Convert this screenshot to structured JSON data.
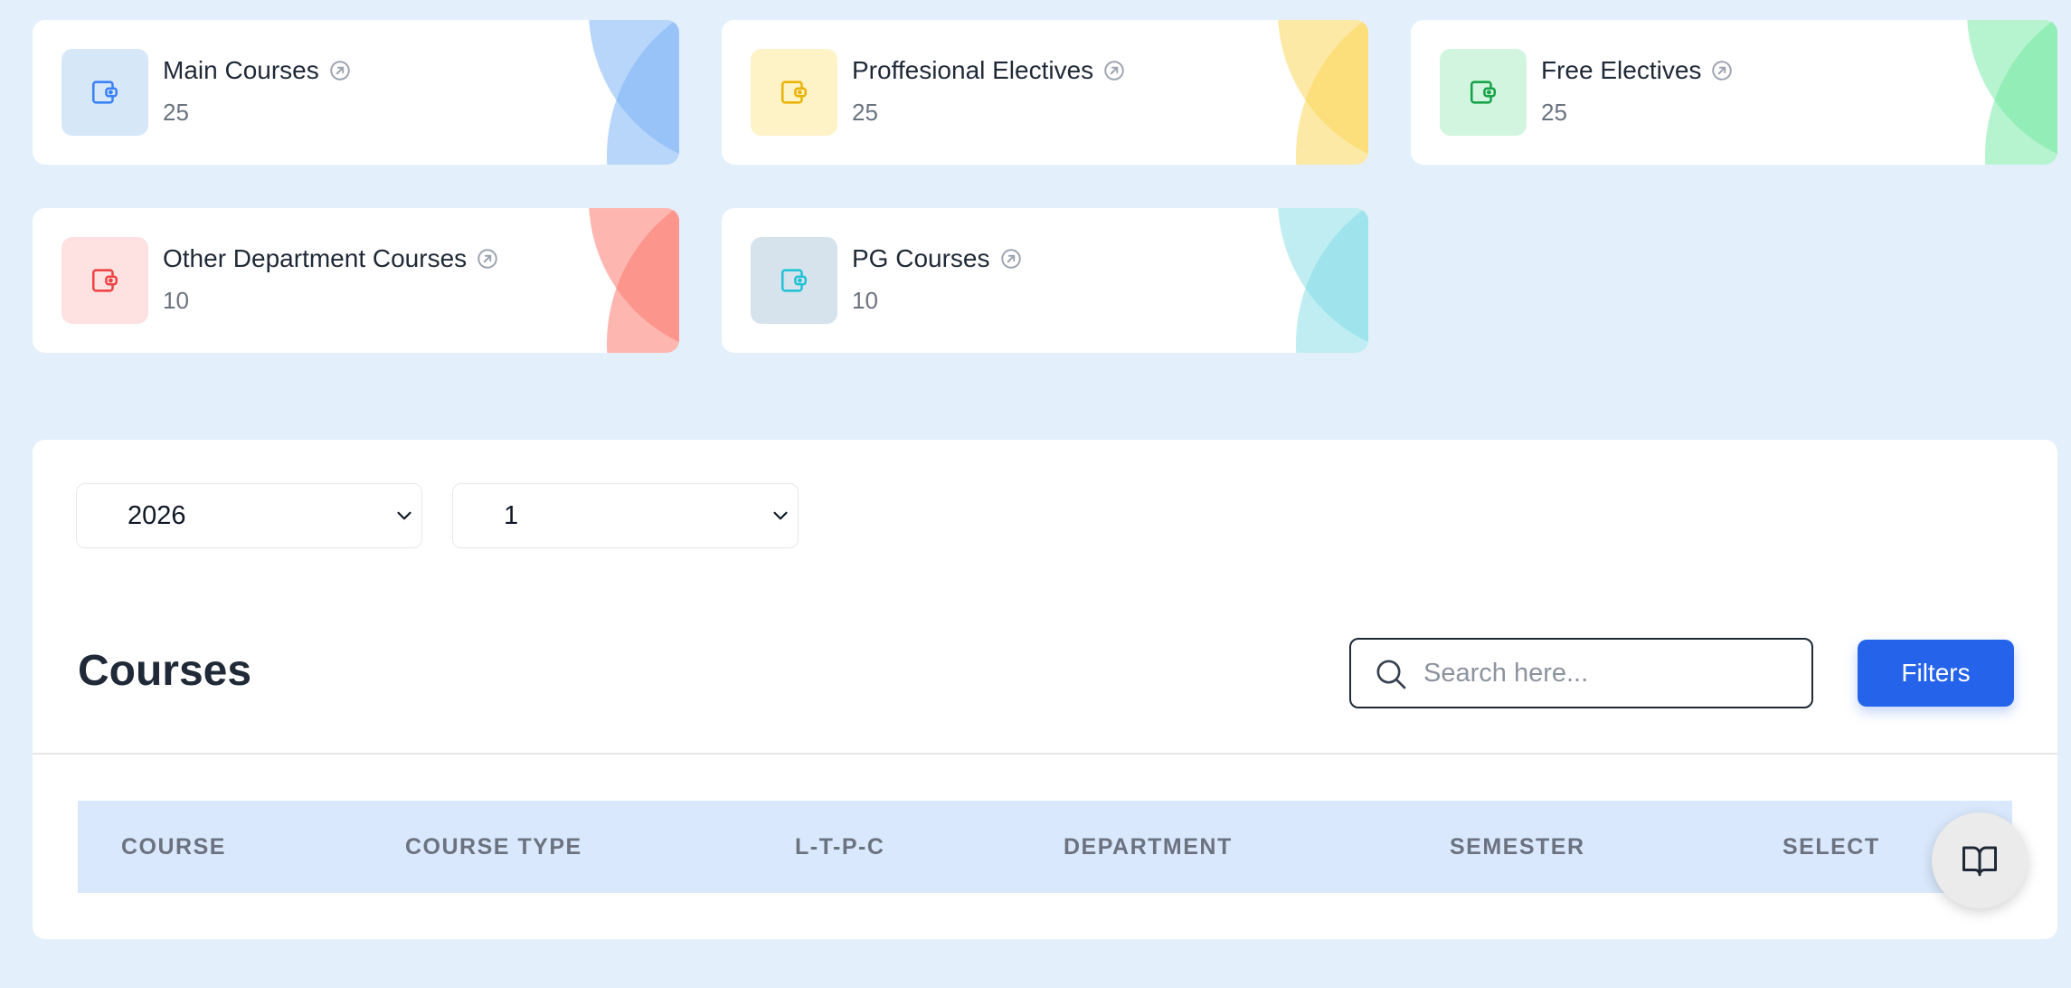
{
  "cards": [
    {
      "title": "Main Courses",
      "count": "25",
      "icon": "wallet-icon",
      "link_icon": "arrow-up-right-circle-icon",
      "accent": "#3b82f6",
      "icon_bg": "#d6e7f8",
      "deco": "#7db4f5"
    },
    {
      "title": "Proffesional Electives",
      "count": "25",
      "icon": "wallet-icon",
      "link_icon": "arrow-up-right-circle-icon",
      "accent": "#eab308",
      "icon_bg": "#fef3c7",
      "deco": "#fcd34d"
    },
    {
      "title": "Free Electives",
      "count": "25",
      "icon": "wallet-icon",
      "link_icon": "arrow-up-right-circle-icon",
      "accent": "#16a34a",
      "icon_bg": "#d1f5de",
      "deco": "#6ee7a0"
    },
    {
      "title": "Other Department Courses",
      "count": "10",
      "icon": "wallet-icon",
      "link_icon": "arrow-up-right-circle-icon",
      "accent": "#ef4444",
      "icon_bg": "#fee2e2",
      "deco": "#fb7c70"
    },
    {
      "title": "PG Courses",
      "count": "10",
      "icon": "wallet-icon",
      "link_icon": "arrow-up-right-circle-icon",
      "accent": "#22c3d6",
      "icon_bg": "#d6e3ec",
      "deco": "#7fdbe6"
    }
  ],
  "filters": {
    "year": {
      "value": "2026"
    },
    "semester": {
      "value": "1"
    }
  },
  "courses": {
    "heading": "Courses",
    "search_placeholder": "Search here...",
    "filters_label": "Filters",
    "columns": [
      "COURSE",
      "COURSE TYPE",
      "L-T-P-C",
      "DEPARTMENT",
      "SEMESTER",
      "SELECT"
    ]
  },
  "fab": {
    "icon": "open-book-icon"
  },
  "colors": {
    "page_bg": "#e3f0fc",
    "primary": "#2563eb",
    "table_header_bg": "#d9e8fc"
  }
}
